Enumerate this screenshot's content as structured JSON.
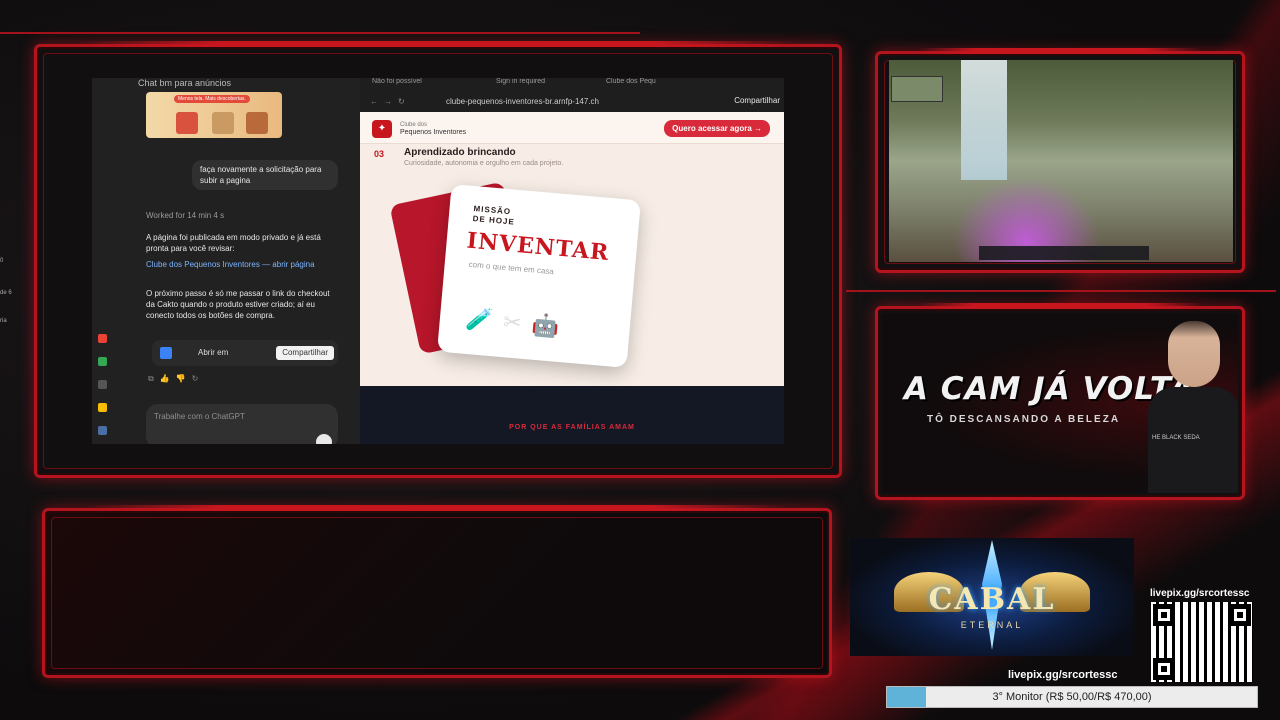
{
  "chatgpt": {
    "header": "Chat bm para anúncios",
    "image_pill": "Menos tela. Mais descobertas.",
    "user_message": "faça novamente a solicitação para subir a pagina",
    "worked": "Worked for 14 min 4 s",
    "paragraph1": "A página foi publicada em modo privado e já está pronta para você revisar:",
    "link": "Clube dos Pequenos Inventores — abrir página",
    "paragraph2": "O próximo passo é só me passar o link do checkout da Cakto quando o produto estiver criado; aí eu conecto todos os botões de compra.",
    "open_in": "Abrir em",
    "share": "Compartilhar",
    "input_placeholder": "Trabalhe com o ChatGPT"
  },
  "left_strip": [
    "0",
    "de 6",
    "ria"
  ],
  "browser": {
    "tab1": "Não foi possível",
    "tab2": "Sign in required",
    "tab3": "Clube dos Pequ",
    "url": "clube-pequenos-inventores-br.arnfp-147.ch",
    "share": "Compartilhar"
  },
  "site": {
    "brand_small": "Clube dos",
    "brand": "Pequenos Inventores",
    "cta": "Quero acessar agora →",
    "step_number": "03",
    "step_title": "Aprendizado brincando",
    "step_subtitle": "Curiosidade, autonomia e orgulho em cada projeto.",
    "card_kicker": "MISSÃO\nDE HOJE",
    "card_title": "INVENTAR",
    "card_subtitle": "com o que tem em casa",
    "card_icons": "🧪✂🤖",
    "section_kicker": "POR QUE AS FAMÍLIAS AMAM"
  },
  "cam": {
    "title": "A CAM JÁ VOLTA",
    "subtitle": "TÔ DESCANSANDO A BELEZA",
    "shirt_text": "HE BLACK SEDA"
  },
  "logo": {
    "word": "CABAL",
    "tag": "ETERNAL"
  },
  "pix": {
    "top": "livepix.gg/srcortessc",
    "bottom": "livepix.gg/srcortessc"
  },
  "goal": {
    "label": "3° Monitor (R$ 50,00/R$ 470,00)",
    "progress": 0.106
  },
  "colors": {
    "accent_red": "#c8161f",
    "goal_fill": "#5fb3d9",
    "link_blue": "#7db4ff"
  }
}
